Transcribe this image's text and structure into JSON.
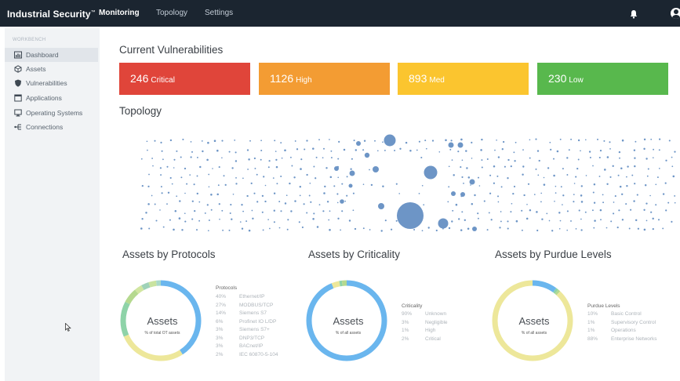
{
  "header": {
    "brand": "Industrial Security",
    "brand_mark": "™",
    "nav": [
      "Monitoring",
      "Topology",
      "Settings"
    ],
    "icons": [
      "bell-icon",
      "user-avatar-icon"
    ]
  },
  "sidebar": {
    "heading": "WORKBENCH",
    "items": [
      {
        "label": "Dashboard",
        "icon": "dashboard-icon"
      },
      {
        "label": "Assets",
        "icon": "assets-icon"
      },
      {
        "label": "Vulnerabilities",
        "icon": "shield-icon"
      },
      {
        "label": "Applications",
        "icon": "applications-icon"
      },
      {
        "label": "Operating Systems",
        "icon": "monitor-icon"
      },
      {
        "label": "Connections",
        "icon": "connections-icon"
      }
    ]
  },
  "vulnerabilities": {
    "title": "Current Vulnerabilities",
    "cards": [
      {
        "count": "246",
        "label": "Critical",
        "color": "#e0453a"
      },
      {
        "count": "1126",
        "label": "High",
        "color": "#f39c33"
      },
      {
        "count": "893",
        "label": "Med",
        "color": "#fbc52f"
      },
      {
        "count": "230",
        "label": "Low",
        "color": "#58b84d"
      }
    ]
  },
  "topology": {
    "title": "Topology"
  },
  "donuts": [
    {
      "title": "Assets by Protocols",
      "center": "Assets",
      "sub": "% of total OT assets",
      "legend_title": "Protocols",
      "legend": [
        {
          "pct": "40%",
          "name": "Ethernet/IP"
        },
        {
          "pct": "27%",
          "name": "MODBUS/TCP"
        },
        {
          "pct": "14%",
          "name": "Siemens S7"
        },
        {
          "pct": "6%",
          "name": "Profinet IO L/DP"
        },
        {
          "pct": "3%",
          "name": "Siemens S7+"
        },
        {
          "pct": "3%",
          "name": "DNP3/TCP"
        },
        {
          "pct": "3%",
          "name": "BACnet/IP"
        },
        {
          "pct": "2%",
          "name": "IEC 60870-5-104"
        }
      ],
      "segments": [
        {
          "value": 40,
          "color": "#6ab6ee"
        },
        {
          "value": 27,
          "color": "#ede79a"
        },
        {
          "value": 14,
          "color": "#8ed3a8"
        },
        {
          "value": 6,
          "color": "#b5d98f"
        },
        {
          "value": 3,
          "color": "#d1e6a1"
        },
        {
          "value": 3,
          "color": "#9fd2b8"
        },
        {
          "value": 3,
          "color": "#c9e3a0"
        },
        {
          "value": 2,
          "color": "#a9d9c9"
        }
      ]
    },
    {
      "title": "Assets by Criticality",
      "center": "Assets",
      "sub": "% of all assets",
      "legend_title": "Criticality",
      "legend": [
        {
          "pct": "90%",
          "name": "Unknown"
        },
        {
          "pct": "3%",
          "name": "Negligible"
        },
        {
          "pct": "1%",
          "name": "High"
        },
        {
          "pct": "2%",
          "name": "Critical"
        }
      ],
      "segments": [
        {
          "value": 90,
          "color": "#6ab6ee"
        },
        {
          "value": 3,
          "color": "#ede79a"
        },
        {
          "value": 1,
          "color": "#8ed3a8"
        },
        {
          "value": 2,
          "color": "#b5d98f"
        }
      ]
    },
    {
      "title": "Assets by Purdue Levels",
      "center": "Assets",
      "sub": "% of all assets",
      "legend_title": "Purdue Levels",
      "legend": [
        {
          "pct": "10%",
          "name": "Basic Control"
        },
        {
          "pct": "1%",
          "name": "Supervisory Control"
        },
        {
          "pct": "1%",
          "name": "Operations"
        },
        {
          "pct": "88%",
          "name": "Enterprise Networks"
        }
      ],
      "segments": [
        {
          "value": 10,
          "color": "#6ab6ee"
        },
        {
          "value": 1,
          "color": "#8ed3a8"
        },
        {
          "value": 1,
          "color": "#b5d98f"
        },
        {
          "value": 88,
          "color": "#ede79a"
        }
      ]
    }
  ]
}
